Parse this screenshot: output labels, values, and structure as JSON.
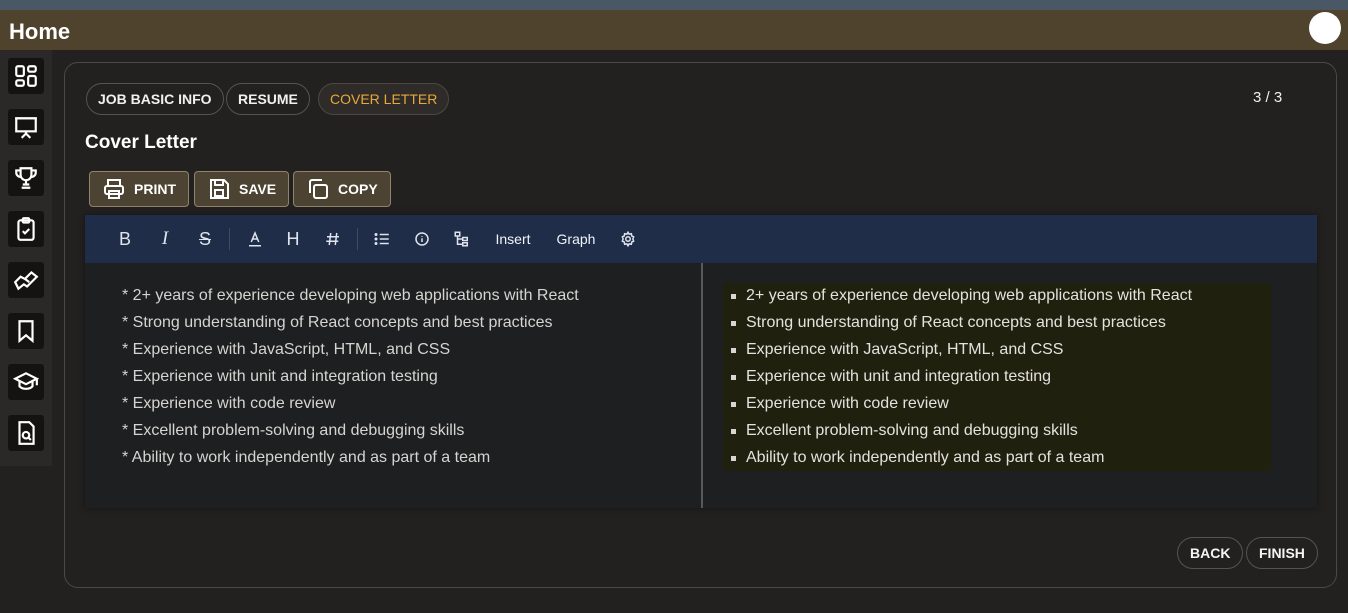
{
  "app": {
    "title": "Home"
  },
  "sidebar": {
    "items": [
      {
        "icon": "dashboard-icon"
      },
      {
        "icon": "presentation-icon"
      },
      {
        "icon": "trophy-icon"
      },
      {
        "icon": "clipboard-check-icon"
      },
      {
        "icon": "handshake-icon"
      },
      {
        "icon": "bookmark-icon"
      },
      {
        "icon": "graduation-cap-icon"
      },
      {
        "icon": "document-search-icon"
      }
    ]
  },
  "steps": {
    "items": [
      {
        "label": "JOB BASIC INFO"
      },
      {
        "label": "RESUME"
      },
      {
        "label": "COVER LETTER"
      }
    ],
    "active_index": 2,
    "active_color": "#e8a83d",
    "pager": "3 / 3"
  },
  "section": {
    "title": "Cover Letter"
  },
  "actions": {
    "print_label": "PRINT",
    "save_label": "SAVE",
    "copy_label": "COPY"
  },
  "toolbar": {
    "bold": "B",
    "italic": "I",
    "strike": "S",
    "heading": "H",
    "insert_label": "Insert",
    "graph_label": "Graph"
  },
  "editor": {
    "source_lines": [
      "* 2+ years of experience developing web applications with React",
      "* Strong understanding of React concepts and best practices",
      "* Experience with JavaScript, HTML, and CSS",
      "* Experience with unit and integration testing",
      "* Experience with code review",
      "* Excellent problem-solving and debugging skills",
      "* Ability to work independently and as part of a team"
    ],
    "preview_items": [
      "2+ years of experience developing web applications with React",
      "Strong understanding of React concepts and best practices",
      "Experience with JavaScript, HTML, and CSS",
      "Experience with unit and integration testing",
      "Experience with code review",
      "Excellent problem-solving and debugging skills",
      "Ability to work independently and as part of a team"
    ]
  },
  "footer": {
    "back_label": "BACK",
    "finish_label": "FINISH"
  },
  "colors": {
    "appbar": "#50432e",
    "toolbar": "#1f2d49",
    "accent": "#e8a83d",
    "action_button": "#4d4332"
  }
}
